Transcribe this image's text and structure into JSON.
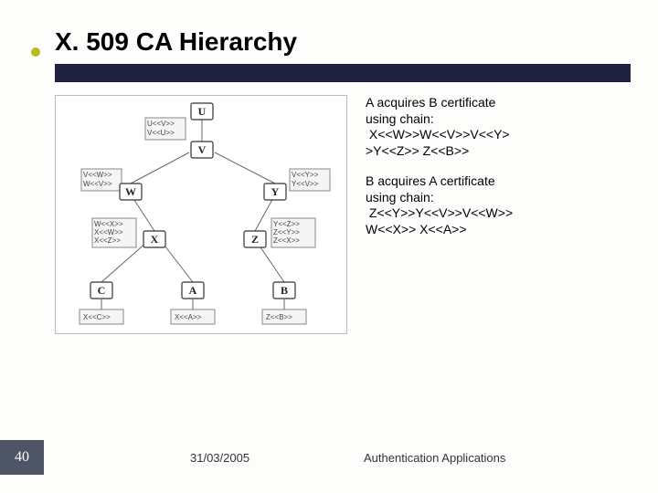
{
  "slide": {
    "title": "X. 509 CA Hierarchy",
    "para1": {
      "line1": "A acquires B certificate",
      "line2": "using chain:",
      "chain1a": " X<<W>>W<<V>>V<<Y>",
      "chain1b": ">Y<<Z>> Z<<B>>"
    },
    "para2": {
      "line1": "B acquires A certificate",
      "line2": "using chain:",
      "chain2a": " Z<<Y>>Y<<V>>V<<W>>",
      "chain2b": "W<<X>> X<<A>>"
    }
  },
  "diagram": {
    "nodes": {
      "U": "U",
      "V": "V",
      "W": "W",
      "Y": "Y",
      "X": "X",
      "Z": "Z",
      "C": "C",
      "A": "A",
      "B": "B"
    },
    "cert": {
      "u_v": "U<<V>>\nV<<U>>",
      "v_w": "V<<W>>\nW<<V>>",
      "v_y": "V<<Y>>\nY<<V>>",
      "w_x": "W<<X>>\nX<<W>>\nX<<Z>>",
      "y_z": "Y<<Z>>\nZ<<Y>>\nZ<<X>>",
      "x_c": "X<<C>>",
      "x_a": "X<<A>>",
      "z_b": "Z<<B>>"
    }
  },
  "footer": {
    "page": "40",
    "date": "31/03/2005",
    "text": "Authentication Applications"
  }
}
